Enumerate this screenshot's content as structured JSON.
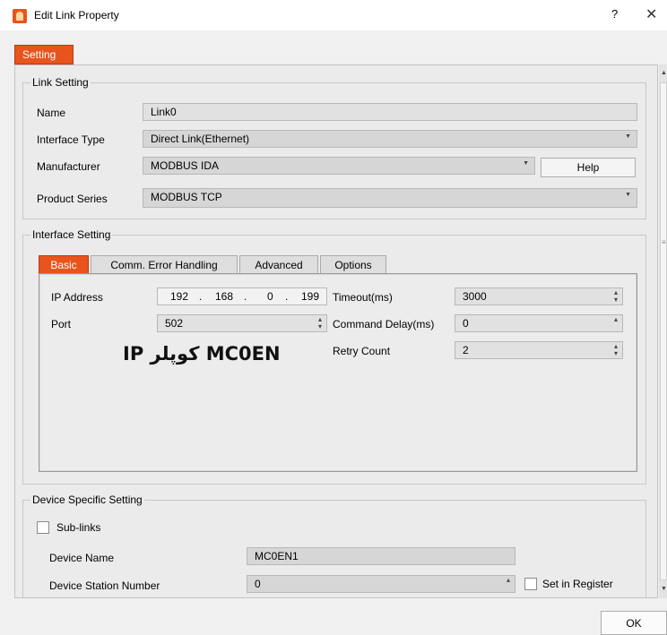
{
  "window": {
    "title": "Edit Link Property",
    "help": "?",
    "close": "✕"
  },
  "main_tab": "Setting",
  "link_setting": {
    "legend": "Link Setting",
    "name_label": "Name",
    "name_value": "Link0",
    "interface_label": "Interface Type",
    "interface_value": "Direct Link(Ethernet)",
    "manufacturer_label": "Manufacturer",
    "manufacturer_value": "MODBUS IDA",
    "help_button": "Help",
    "series_label": "Product Series",
    "series_value": "MODBUS TCP"
  },
  "interface_setting": {
    "legend": "Interface Setting",
    "tabs": [
      "Basic",
      "Comm. Error Handling",
      "Advanced",
      "Options"
    ],
    "active_tab": "Basic",
    "ip_label": "IP Address",
    "ip": [
      "192",
      "168",
      "0",
      "199"
    ],
    "port_label": "Port",
    "port_value": "502",
    "timeout_label": "Timeout(ms)",
    "timeout_value": "3000",
    "delay_label": "Command Delay(ms)",
    "delay_value": "0",
    "retry_label": "Retry Count",
    "retry_value": "2",
    "annotation": "IP کوپلر MC0EN"
  },
  "device_setting": {
    "legend": "Device Specific Setting",
    "sublinks_label": "Sub-links",
    "sublinks_checked": false,
    "device_name_label": "Device Name",
    "device_name_value": "MC0EN1",
    "station_label": "Device Station Number",
    "station_value": "0",
    "register_label": "Set in Register",
    "register_checked": false
  },
  "footer": {
    "ok_button": "OK"
  },
  "colors": {
    "accent": "#e8541c",
    "background": "#f0f0f0",
    "panel": "#ebebeb"
  }
}
